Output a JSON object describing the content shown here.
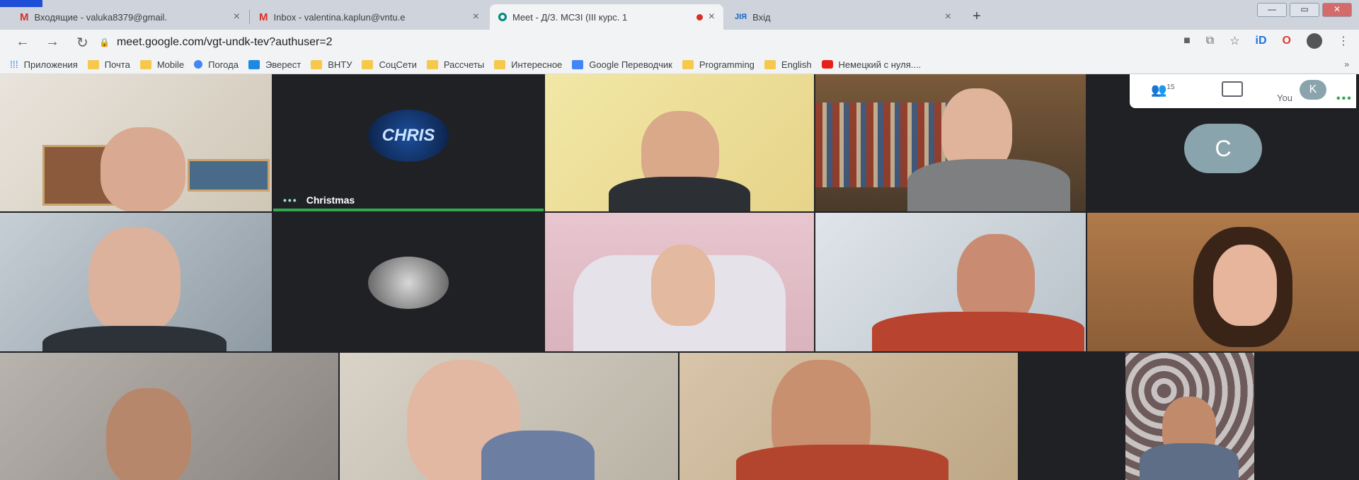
{
  "tabs": [
    {
      "icon": "gmail-icon",
      "title": "Входящие - valuka8379@gmail.",
      "close": "×"
    },
    {
      "icon": "gmail-icon",
      "title": "Inbox - valentina.kaplun@vntu.e",
      "close": "×"
    },
    {
      "icon": "meet-icon",
      "title": "Meet - Д/З. МСЗІ (ІІІ курс. 1",
      "close": "×",
      "active": true
    },
    {
      "icon": "jitsi-icon",
      "title": "Вхід",
      "close": "×",
      "badge": "JIЯ"
    }
  ],
  "new_tab": "+",
  "window_buttons": [
    "—",
    "▭",
    "✕"
  ],
  "address": {
    "url": "meet.google.com/vgt-undk-tev?authuser=2"
  },
  "toolbar_extensions": {
    "id_label": "iD",
    "opera_label": "O"
  },
  "bookmarks": [
    {
      "label": "Приложения",
      "icon": "apps-icon"
    },
    {
      "label": "Почта",
      "icon": "folder-icon"
    },
    {
      "label": "Mobile",
      "icon": "folder-icon"
    },
    {
      "label": "Погода",
      "icon": "weather-icon"
    },
    {
      "label": "Эверест",
      "icon": "mountain-icon"
    },
    {
      "label": "ВНТУ",
      "icon": "folder-icon"
    },
    {
      "label": "СоцСети",
      "icon": "folder-icon"
    },
    {
      "label": "Рассчеты",
      "icon": "folder-icon"
    },
    {
      "label": "Интересное",
      "icon": "folder-icon"
    },
    {
      "label": "Google Переводчик",
      "icon": "translate-icon"
    },
    {
      "label": "Programming",
      "icon": "folder-icon"
    },
    {
      "label": "English",
      "icon": "folder-icon"
    },
    {
      "label": "Немецкий с нуля....",
      "icon": "youtube-icon"
    }
  ],
  "bookmarks_more": "»",
  "meet": {
    "participant_count": "15",
    "self_label": "You",
    "self_initial": "K",
    "christmas_name": "Christmas",
    "christmas_logo": "CHRIS",
    "tile_initial": "C",
    "speaking_dots": "•••"
  }
}
